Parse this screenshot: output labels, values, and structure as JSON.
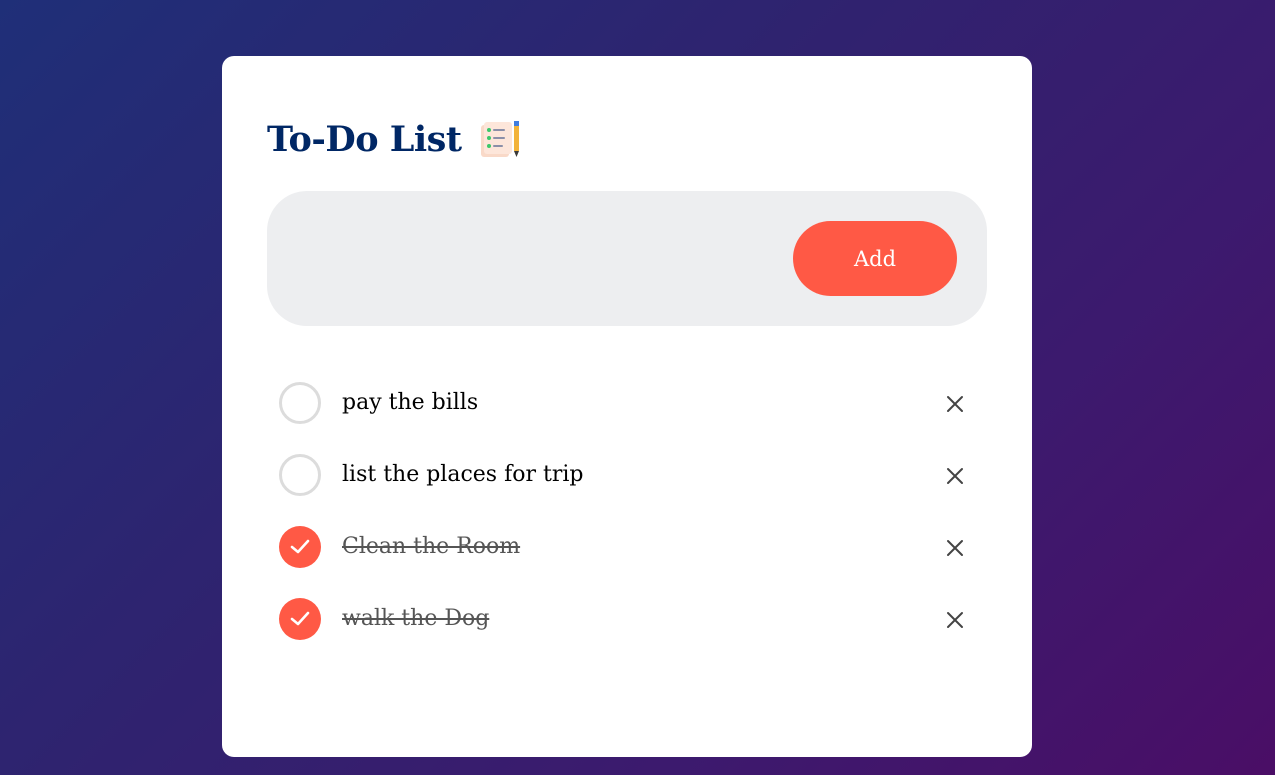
{
  "app": {
    "title": "To-Do List",
    "title_icon": "checklist-notepad-pencil-icon"
  },
  "input": {
    "value": "",
    "placeholder": ""
  },
  "add_button": {
    "label": "Add"
  },
  "colors": {
    "accent": "#ff5945",
    "title": "#002765",
    "input_bg": "#edeef0",
    "background_start": "#1f2f78",
    "background_end": "#4a0e66"
  },
  "tasks": [
    {
      "text": "pay the bills",
      "checked": false,
      "delete_icon": "close-icon"
    },
    {
      "text": "list the places for trip",
      "checked": false,
      "delete_icon": "close-icon"
    },
    {
      "text": "Clean the Room",
      "checked": true,
      "delete_icon": "close-icon"
    },
    {
      "text": "walk the Dog",
      "checked": true,
      "delete_icon": "close-icon"
    }
  ]
}
